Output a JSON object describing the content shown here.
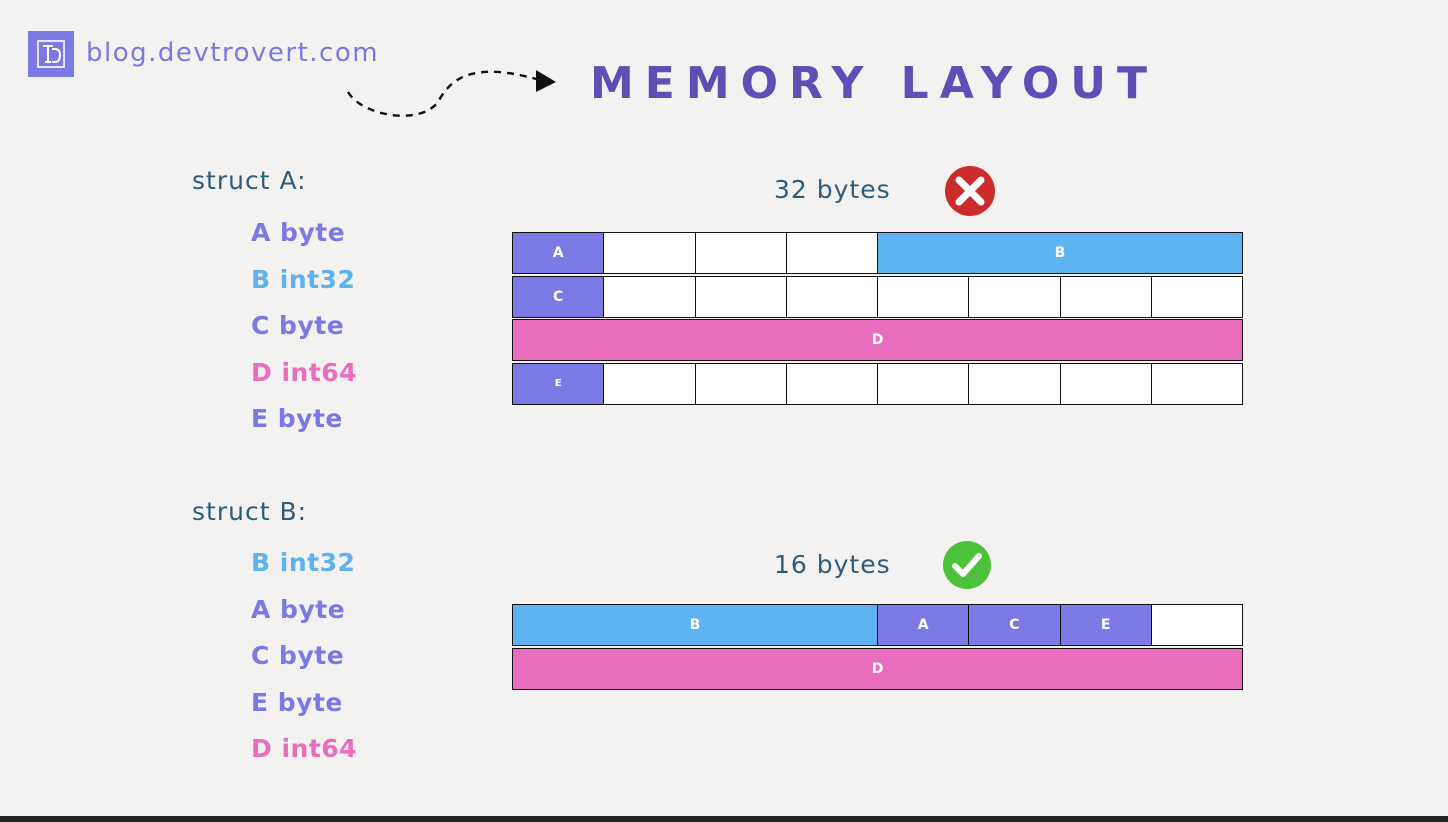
{
  "header": {
    "site_url": "blog.devtrovert.com",
    "title": "MEMORY LAYOUT",
    "logo_icon": "devtrovert-logo-icon",
    "arrow_icon": "dashed-curved-arrow-icon"
  },
  "colors": {
    "byte": "#7b79e3",
    "int32": "#5db2f0",
    "int64": "#ea6cbd",
    "empty": "#ffffff",
    "title": "#5d4fb6",
    "text": "#2e5c7c",
    "bad": "#cc2b2b",
    "good": "#4cc13a"
  },
  "struct_a": {
    "label": "struct A:",
    "fields": [
      {
        "name": "A byte",
        "type": "byte"
      },
      {
        "name": "B int32",
        "type": "int32"
      },
      {
        "name": "C byte",
        "type": "byte"
      },
      {
        "name": "D int64",
        "type": "int64"
      },
      {
        "name": "E byte",
        "type": "byte"
      }
    ],
    "size_label": "32 bytes",
    "status": "cross-icon",
    "rows": [
      [
        {
          "label": "A",
          "type": "byte",
          "span": 1
        },
        {
          "label": "",
          "type": "empty",
          "span": 1
        },
        {
          "label": "",
          "type": "empty",
          "span": 1
        },
        {
          "label": "",
          "type": "empty",
          "span": 1
        },
        {
          "label": "B",
          "type": "int32",
          "span": 4
        }
      ],
      [
        {
          "label": "C",
          "type": "byte",
          "span": 1
        },
        {
          "label": "",
          "type": "empty",
          "span": 1
        },
        {
          "label": "",
          "type": "empty",
          "span": 1
        },
        {
          "label": "",
          "type": "empty",
          "span": 1
        },
        {
          "label": "",
          "type": "empty",
          "span": 1
        },
        {
          "label": "",
          "type": "empty",
          "span": 1
        },
        {
          "label": "",
          "type": "empty",
          "span": 1
        },
        {
          "label": "",
          "type": "empty",
          "span": 1
        }
      ],
      [
        {
          "label": "D",
          "type": "int64",
          "span": 8
        }
      ],
      [
        {
          "label": "E",
          "type": "byte",
          "span": 1
        },
        {
          "label": "",
          "type": "empty",
          "span": 1
        },
        {
          "label": "",
          "type": "empty",
          "span": 1
        },
        {
          "label": "",
          "type": "empty",
          "span": 1
        },
        {
          "label": "",
          "type": "empty",
          "span": 1
        },
        {
          "label": "",
          "type": "empty",
          "span": 1
        },
        {
          "label": "",
          "type": "empty",
          "span": 1
        },
        {
          "label": "",
          "type": "empty",
          "span": 1
        }
      ]
    ]
  },
  "struct_b": {
    "label": "struct B:",
    "fields": [
      {
        "name": "B int32",
        "type": "int32"
      },
      {
        "name": "A byte",
        "type": "byte"
      },
      {
        "name": "C byte",
        "type": "byte"
      },
      {
        "name": "E byte",
        "type": "byte"
      },
      {
        "name": "D int64",
        "type": "int64"
      }
    ],
    "size_label": "16 bytes",
    "status": "check-icon",
    "rows": [
      [
        {
          "label": "B",
          "type": "int32",
          "span": 4
        },
        {
          "label": "A",
          "type": "byte",
          "span": 1
        },
        {
          "label": "C",
          "type": "byte",
          "span": 1
        },
        {
          "label": "E",
          "type": "byte",
          "span": 1
        },
        {
          "label": "",
          "type": "empty",
          "span": 1
        }
      ],
      [
        {
          "label": "D",
          "type": "int64",
          "span": 8
        }
      ]
    ]
  }
}
